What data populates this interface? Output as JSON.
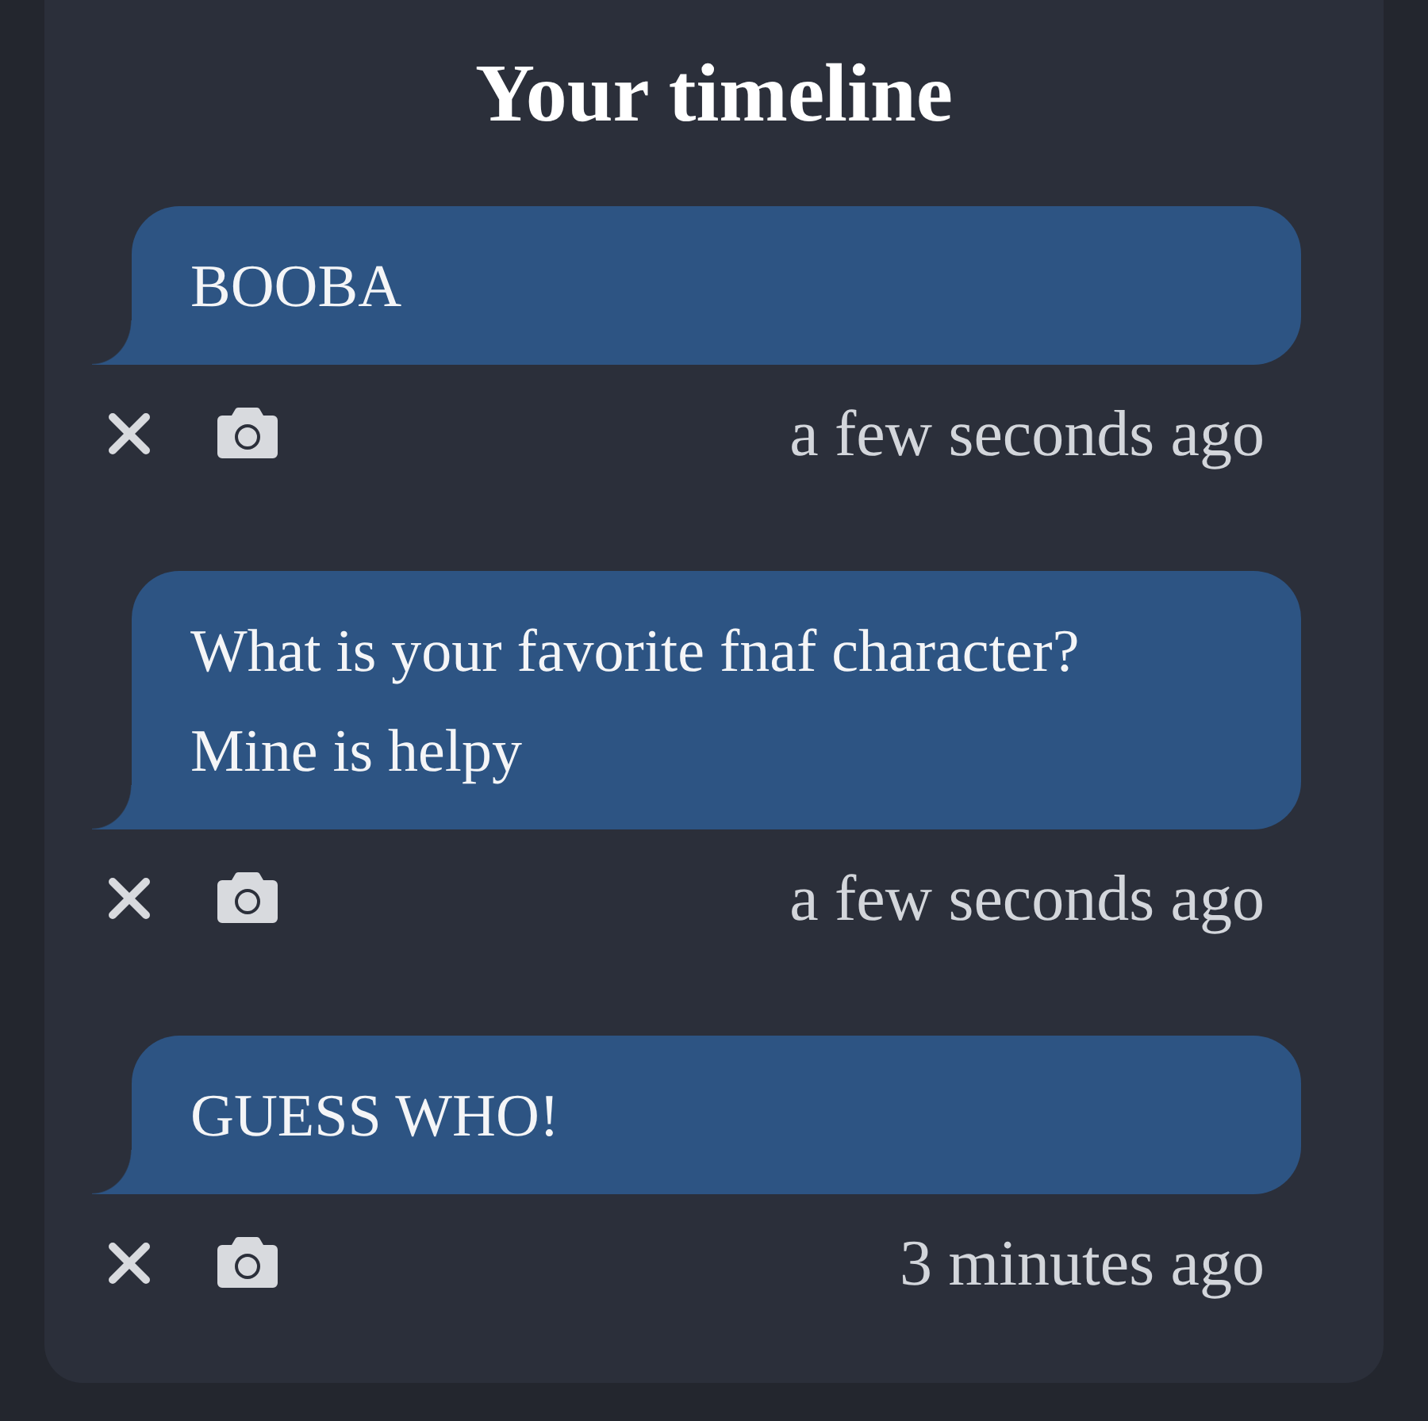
{
  "panel": {
    "title": "Your timeline"
  },
  "posts": [
    {
      "text": "BOOBA",
      "time": "a few seconds ago"
    },
    {
      "text": "What is your favorite fnaf character? Mine is helpy",
      "time": "a few seconds ago"
    },
    {
      "text": "GUESS WHO!",
      "time": "3 minutes ago"
    }
  ]
}
